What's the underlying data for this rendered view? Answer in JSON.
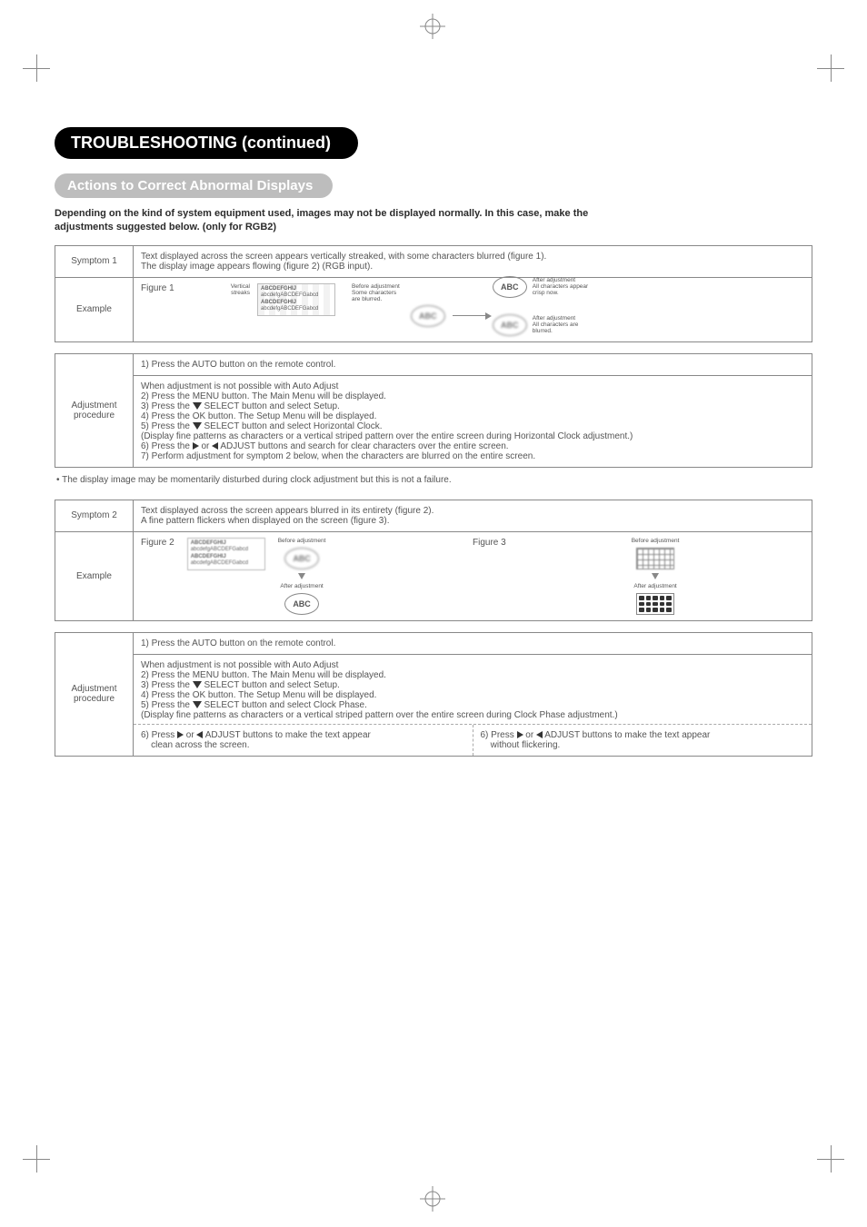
{
  "title": "TROUBLESHOOTING (continued)",
  "subtitle": "Actions to Correct Abnormal Displays",
  "intro_line1": "Depending on the kind of system equipment used, images may not be displayed normally.  In this case, make the",
  "intro_line2": "adjustments suggested below. (only for RGB2)",
  "s1": {
    "row_label": "Symptom 1",
    "desc_line1": "Text displayed across the screen appears vertically streaked, with some characters blurred (figure 1).",
    "desc_line2": "The display image appears flowing (figure 2) (RGB input).",
    "example_label": "Example",
    "figure_label": "Figure 1",
    "streaks_label": "Vertical\nstreaks",
    "box_line1": "ABCDEFGHIJ",
    "box_line2": "abcdefgABCDEFGabcd",
    "box_line3": "ABCDEFGHIJ",
    "box_line4": "abcdefgABCDEFGabcd",
    "before_head": "Before adjustment",
    "before_body": "Some characters\nare blurred.",
    "lens_text": "ABC",
    "after1_head": "After adjustment",
    "after1_body": "All characters appear\ncrisp now.",
    "after2_head": "After adjustment",
    "after2_body": "All characters are\nblurred.",
    "adj_label_a": "Adjustment",
    "adj_label_b": "procedure",
    "step_auto": "1) Press the AUTO button on the remote control.",
    "sub_head": "When adjustment is not possible with Auto Adjust",
    "sub2": "2) Press the MENU button. The Main Menu will be displayed.",
    "sub3a": "3) Press the ",
    "sub3b": " SELECT button and select Setup.",
    "sub4": "4) Press the OK button. The Setup Menu will be displayed.",
    "sub5a": "5) Press the ",
    "sub5b": " SELECT button and select Horizontal Clock.",
    "sub_disp": "(Display fine patterns as characters or a vertical striped pattern over the entire screen during Horizontal Clock adjustment.)",
    "sub6a": "6) Press the ",
    "sub6b": " or ",
    "sub6c": " ADJUST buttons and search for clear characters over the entire screen.",
    "sub7": "7) Perform adjustment for symptom 2 below, when the characters are blurred on the entire screen."
  },
  "note1": "• The display image may be momentarily disturbed during clock adjustment but this is not a failure.",
  "s2": {
    "row_label": "Symptom 2",
    "desc_line1": "Text displayed across the screen appears blurred in its entirety (figure 2).",
    "desc_line2": "A fine pattern flickers when displayed on the screen (figure 3).",
    "example_label": "Example",
    "fig2_label": "Figure 2",
    "fig3_label": "Figure 3",
    "before": "Before adjustment",
    "after": "After adjustment",
    "box_line1": "ABCDEFGHIJ",
    "box_line2": "abcdefgABCDEFGabcd",
    "box_line3": "ABCDEFGHIJ",
    "box_line4": "abcdefgABCDEFGabcd",
    "lens_text": "ABC",
    "adj_label_a": "Adjustment",
    "adj_label_b": "procedure",
    "step_auto": "1) Press the AUTO button on the remote control.",
    "sub_head": "When adjustment is not possible with Auto Adjust",
    "sub2": "2) Press the MENU button. The Main Menu will be displayed.",
    "sub3a": "3) Press the ",
    "sub3b": " SELECT button and select Setup.",
    "sub4": "4) Press the OK button. The Setup Menu will be displayed.",
    "sub5a": "5) Press the ",
    "sub5b": " SELECT button and select Clock Phase.",
    "sub_disp": "(Display fine patterns as characters or a vertical striped pattern over the entire screen during Clock Phase adjustment.)",
    "left6a": "6) Press ",
    "left6b": " or ",
    "left6c": " ADJUST buttons to make the text appear",
    "left6d": "clean across the screen.",
    "right6a": "6) Press ",
    "right6b": " or ",
    "right6c": " ADJUST buttons to make the text appear",
    "right6d": "without flickering."
  }
}
